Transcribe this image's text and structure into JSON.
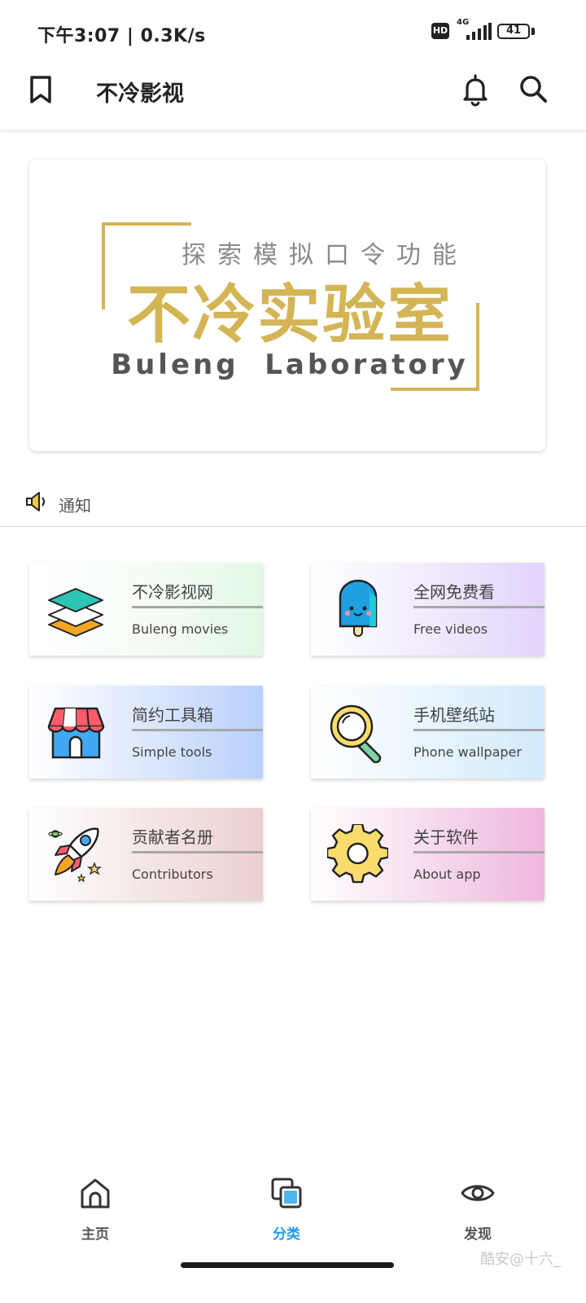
{
  "status_bar": {
    "time": "下午3:07 | 0.3K/s",
    "hd": "HD",
    "network": "4G",
    "battery": "41",
    "battery_level": 0.41
  },
  "app_bar": {
    "title": "不冷影视",
    "icons": [
      "bookmark-icon",
      "bell-icon",
      "search-icon"
    ]
  },
  "banner": {
    "subtitle": "探索模拟口令功能",
    "title": "不冷实验室",
    "english": "Buleng  Laboratory",
    "accent": "#d3b556"
  },
  "notice": {
    "label": "通知",
    "icon": "speaker-icon"
  },
  "cards": [
    {
      "title": "不冷影视网",
      "subtitle": "Buleng movies",
      "icon": "layers-icon",
      "tint": "#e2f8e4"
    },
    {
      "title": "全网免费看",
      "subtitle": "Free videos",
      "icon": "popsicle-icon",
      "tint": "#e2d4fb"
    },
    {
      "title": "简约工具箱",
      "subtitle": "Simple tools",
      "icon": "shop-icon",
      "tint": "#b8d0fb"
    },
    {
      "title": "手机壁纸站",
      "subtitle": "Phone wallpaper",
      "icon": "magnifier-icon",
      "tint": "#d2eafb"
    },
    {
      "title": "贡献者名册",
      "subtitle": "Contributors",
      "icon": "rocket-icon",
      "tint": "#ecd0d0"
    },
    {
      "title": "关于软件",
      "subtitle": "About app",
      "icon": "gear-icon",
      "tint": "#efb6de"
    }
  ],
  "bottom_nav": {
    "items": [
      {
        "label": "主页",
        "icon": "home-icon"
      },
      {
        "label": "分类",
        "icon": "category-icon",
        "active": true
      },
      {
        "label": "发现",
        "icon": "eye-icon"
      }
    ],
    "active_color": "#1e9be8"
  },
  "watermark": "酷安@十六_"
}
